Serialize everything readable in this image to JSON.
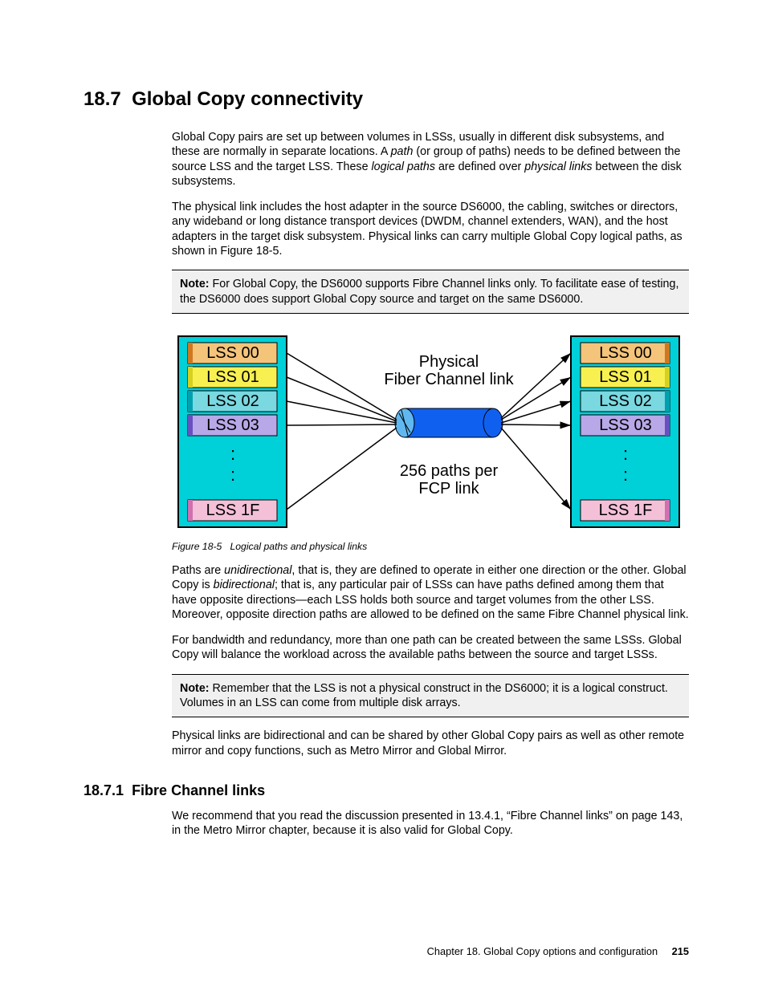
{
  "section": {
    "number": "18.7",
    "title": "Global Copy connectivity"
  },
  "para1_a": "Global Copy pairs are set up between volumes in LSSs, usually in different disk subsystems, and these are normally in separate locations. A ",
  "para1_path": "path",
  "para1_b": " (or group of paths) needs to be defined between the source LSS and the target LSS. These ",
  "para1_logical": "logical paths",
  "para1_c": " are defined over ",
  "para1_physical": "physical links",
  "para1_d": " between the disk subsystems.",
  "para2": "The physical link includes the host adapter in the source DS6000, the cabling, switches or directors, any wideband or long distance transport devices (DWDM, channel extenders, WAN), and the host adapters in the target disk subsystem. Physical links can carry multiple Global Copy logical paths, as shown in Figure 18-5.",
  "note1_label": "Note:",
  "note1_text": " For Global Copy, the DS6000 supports Fibre Channel links only. To facilitate ease of testing, the DS6000 does support Global Copy source and target on the same DS6000.",
  "figure": {
    "caption_prefix": "Figure 18-5",
    "caption_text": "Logical paths and physical links",
    "link_title1": "Physical",
    "link_title2": "Fiber Channel link",
    "paths_line1": "256 paths per",
    "paths_line2": "FCP link",
    "left_lss": [
      "LSS 00",
      "LSS 01",
      "LSS 02",
      "LSS 03"
    ],
    "right_lss": [
      "LSS 00",
      "LSS 01",
      "LSS 02",
      "LSS 03"
    ],
    "lss_last": "LSS 1F"
  },
  "para3_a": "Paths are ",
  "para3_uni": "unidirectional",
  "para3_b": ", that is, they are defined to operate in either one direction or the other. Global Copy is ",
  "para3_bidi": "bidirectional",
  "para3_c": "; that is, any particular pair of LSSs can have paths defined among them that have opposite directions—each LSS holds both source and target volumes from the other LSS. Moreover, opposite direction paths are allowed to be defined on the same Fibre Channel physical link.",
  "para4": "For bandwidth and redundancy, more than one path can be created between the same LSSs. Global Copy will balance the workload across the available paths between the source and target LSSs.",
  "note2_label": "Note:",
  "note2_text": " Remember that the LSS is not a physical construct in the DS6000; it is a logical construct. Volumes in an LSS can come from multiple disk arrays.",
  "para5": "Physical links are bidirectional and can be shared by other Global Copy pairs as well as other remote mirror and copy functions, such as Metro Mirror and Global Mirror.",
  "subsection": {
    "number": "18.7.1",
    "title": "Fibre Channel links"
  },
  "para6": "We recommend that you read the discussion presented in 13.4.1, “Fibre Channel links” on page 143, in the Metro Mirror chapter, because it is also valid for Global Copy.",
  "footer": {
    "chapter": "Chapter 18. Global Copy options and configuration",
    "page": "215"
  }
}
